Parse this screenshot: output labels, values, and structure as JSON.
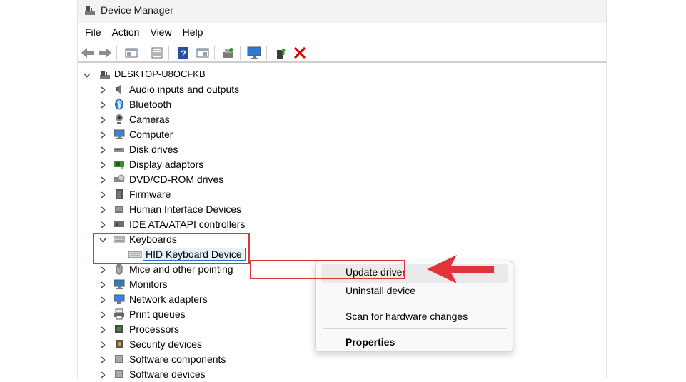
{
  "window": {
    "title": "Device Manager"
  },
  "menu": [
    "File",
    "Action",
    "View",
    "Help"
  ],
  "toolbar": {
    "buttons": [
      "back-icon",
      "forward-icon",
      "properties-pane-icon",
      "details-icon",
      "help-icon",
      "action-pane-icon",
      "scan-icon",
      "monitor-icon",
      "update-driver-icon",
      "uninstall-icon"
    ],
    "uninstall_color": "#d40000"
  },
  "tree": {
    "root": "DESKTOP-U8OCFKB",
    "nodes": [
      {
        "label": "Audio inputs and outputs",
        "icon": "speaker-icon"
      },
      {
        "label": "Bluetooth",
        "icon": "bluetooth-icon"
      },
      {
        "label": "Cameras",
        "icon": "camera-icon"
      },
      {
        "label": "Computer",
        "icon": "computer-icon"
      },
      {
        "label": "Disk drives",
        "icon": "disk-drive-icon"
      },
      {
        "label": "Display adaptors",
        "icon": "display-adaptor-icon"
      },
      {
        "label": "DVD/CD-ROM drives",
        "icon": "dvd-drive-icon"
      },
      {
        "label": "Firmware",
        "icon": "firmware-icon"
      },
      {
        "label": "Human Interface Devices",
        "icon": "hid-icon"
      },
      {
        "label": "IDE ATA/ATAPI controllers",
        "icon": "ide-controller-icon"
      },
      {
        "label": "Keyboards",
        "icon": "keyboard-icon",
        "expanded": true,
        "children": [
          {
            "label": "HID Keyboard Device",
            "icon": "keyboard-icon",
            "selected": true
          }
        ]
      },
      {
        "label": "Mice and other pointing",
        "icon": "mouse-icon"
      },
      {
        "label": "Monitors",
        "icon": "monitor-icon"
      },
      {
        "label": "Network adapters",
        "icon": "network-adapter-icon"
      },
      {
        "label": "Print queues",
        "icon": "printer-icon"
      },
      {
        "label": "Processors",
        "icon": "processor-icon"
      },
      {
        "label": "Security devices",
        "icon": "security-device-icon"
      },
      {
        "label": "Software components",
        "icon": "software-component-icon"
      },
      {
        "label": "Software devices",
        "icon": "software-device-icon"
      }
    ]
  },
  "context_menu": {
    "items": [
      {
        "label": "Update driver",
        "highlighted": true
      },
      {
        "label": "Uninstall device"
      },
      {
        "label": "Scan for hardware changes"
      },
      {
        "label": "Properties",
        "bold": true
      }
    ]
  },
  "annotation": {
    "color": "#e0343a"
  }
}
